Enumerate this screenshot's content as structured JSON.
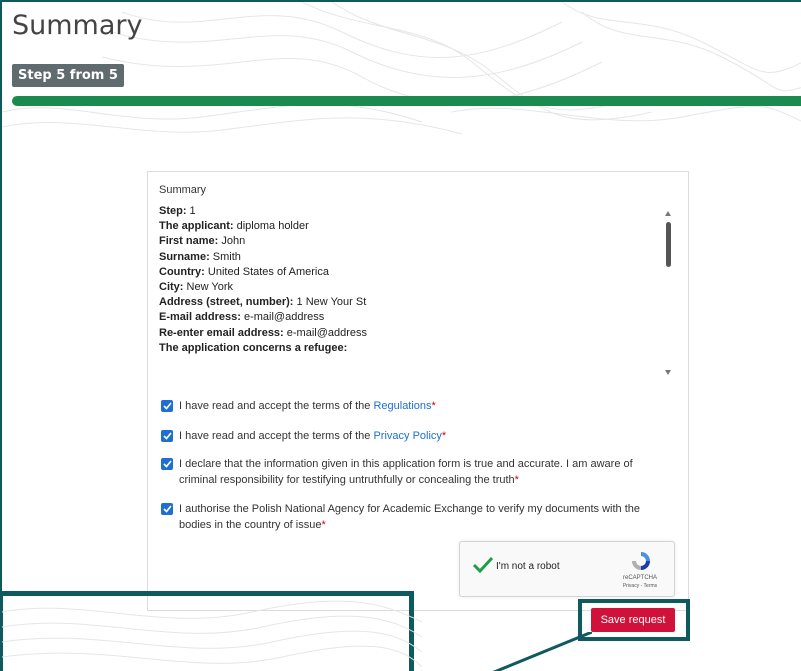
{
  "page": {
    "title": "Summary",
    "step_badge": "Step 5 from 5",
    "progress": 1.0
  },
  "summary": {
    "caption": "Summary",
    "lines": [
      {
        "label": "Step:",
        "value": " 1"
      },
      {
        "label": "The applicant:",
        "value": " diploma holder"
      },
      {
        "label": "First name:",
        "value": " John"
      },
      {
        "label": "Surname:",
        "value": " Smith"
      },
      {
        "label": "Country:",
        "value": " United States of America"
      },
      {
        "label": "City:",
        "value": " New York"
      },
      {
        "label": "Address (street, number):",
        "value": " 1 New Your St"
      },
      {
        "label": "E-mail address:",
        "value": " e-mail@address"
      },
      {
        "label": "Re-enter email address:",
        "value": " e-mail@address"
      },
      {
        "label": "The application concerns a refugee:",
        "value": ""
      }
    ]
  },
  "consents": [
    {
      "text": "I have read and accept the terms of the ",
      "link": "Regulations",
      "required": "*",
      "checked": true
    },
    {
      "text": "I have read and accept the terms of the ",
      "link": "Privacy Policy",
      "required": "*",
      "checked": true
    },
    {
      "text": "I declare that the information given in this application form is true and accurate. I am aware of criminal responsibility for testifying untruthfully or concealing the truth",
      "link": "",
      "required": "*",
      "checked": true
    },
    {
      "text": "I authorise the Polish National Agency for Academic Exchange to verify my documents with the bodies in the country of issue",
      "link": "",
      "required": "*",
      "checked": true
    }
  ],
  "recaptcha": {
    "label": "I'm not a robot",
    "brand": "reCAPTCHA",
    "terms": "Privacy - Terms",
    "checked": true
  },
  "actions": {
    "save_label": "Save request"
  },
  "colors": {
    "accent_green": "#1a8a4e",
    "frame_teal": "#0f5a5e",
    "save_red": "#d0123a",
    "link_blue": "#1f6fd1",
    "badge_grey": "#5f6b6e"
  }
}
